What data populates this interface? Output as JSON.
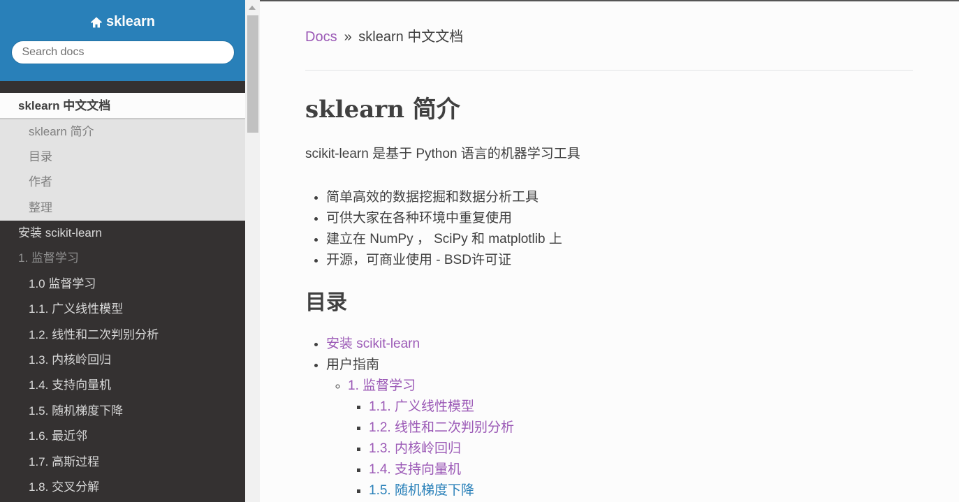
{
  "sidebar": {
    "home_label": "sklearn",
    "search_placeholder": "Search docs",
    "current": "sklearn 中文文档",
    "sub_items": [
      "sklearn 简介",
      "目录",
      "作者",
      "整理"
    ],
    "nav_items": [
      {
        "label": "安装 scikit-learn",
        "indent": false,
        "dim": false
      },
      {
        "label": "1. 监督学习",
        "indent": false,
        "dim": true
      },
      {
        "label": "1.0 监督学习",
        "indent": true,
        "dim": false
      },
      {
        "label": "1.1. 广义线性模型",
        "indent": true,
        "dim": false
      },
      {
        "label": "1.2. 线性和二次判别分析",
        "indent": true,
        "dim": false
      },
      {
        "label": "1.3. 内核岭回归",
        "indent": true,
        "dim": false
      },
      {
        "label": "1.4. 支持向量机",
        "indent": true,
        "dim": false
      },
      {
        "label": "1.5. 随机梯度下降",
        "indent": true,
        "dim": false
      },
      {
        "label": "1.6. 最近邻",
        "indent": true,
        "dim": false
      },
      {
        "label": "1.7. 高斯过程",
        "indent": true,
        "dim": false
      },
      {
        "label": "1.8. 交叉分解",
        "indent": true,
        "dim": false
      }
    ]
  },
  "breadcrumb": {
    "docs": "Docs",
    "sep": "»",
    "current": "sklearn 中文文档"
  },
  "main": {
    "title": "sklearn 简介",
    "intro": "scikit-learn 是基于 Python 语言的机器学习工具",
    "features": [
      "简单高效的数据挖掘和数据分析工具",
      "可供大家在各种环境中重复使用",
      "建立在 NumPy ， SciPy 和 matplotlib 上",
      "开源，可商业使用 - BSD许可证"
    ],
    "toc_title": "目录",
    "toc": {
      "install": "安装 scikit-learn",
      "user_guide": "用户指南",
      "supervised": "1. 监督学习",
      "items": [
        "1.1. 广义线性模型",
        "1.2. 线性和二次判别分析",
        "1.3. 内核岭回归",
        "1.4. 支持向量机",
        "1.5. 随机梯度下降"
      ]
    }
  },
  "colors": {
    "sidebar_bg": "#343131",
    "header_blue": "#2980b9",
    "link_purple": "#9b59b6",
    "link_blue": "#2980b9"
  }
}
